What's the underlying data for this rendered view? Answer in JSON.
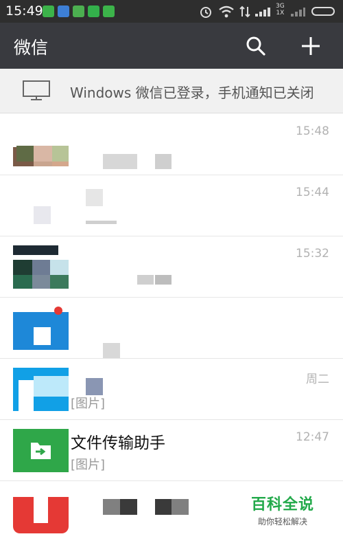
{
  "status_bar": {
    "time": "15:49",
    "network_top": "3G",
    "network_bottom": "1X"
  },
  "header": {
    "title": "微信",
    "search_icon": "search-icon",
    "add_icon": "plus-icon"
  },
  "notice": {
    "icon": "monitor-icon",
    "text": "Windows 微信已登录，手机通知已关闭"
  },
  "chats": [
    {
      "name": "",
      "preview": "",
      "time": "15:48"
    },
    {
      "name": "",
      "preview": "",
      "time": "15:44"
    },
    {
      "name": "",
      "preview": "",
      "time": "15:32"
    },
    {
      "name": "",
      "preview": "",
      "time": ""
    },
    {
      "name": "",
      "preview": "[图片]",
      "time": "周二"
    },
    {
      "name": "文件传输助手",
      "preview": "[图片]",
      "time": "12:47"
    },
    {
      "name": "",
      "preview": "",
      "time": ""
    }
  ],
  "watermark": {
    "title": "百科全说",
    "subtitle": "助你轻松解决"
  },
  "colors": {
    "title_bar": "#393a3f",
    "status_bar": "#2e2e2e",
    "file_helper_green": "#2fa749"
  }
}
